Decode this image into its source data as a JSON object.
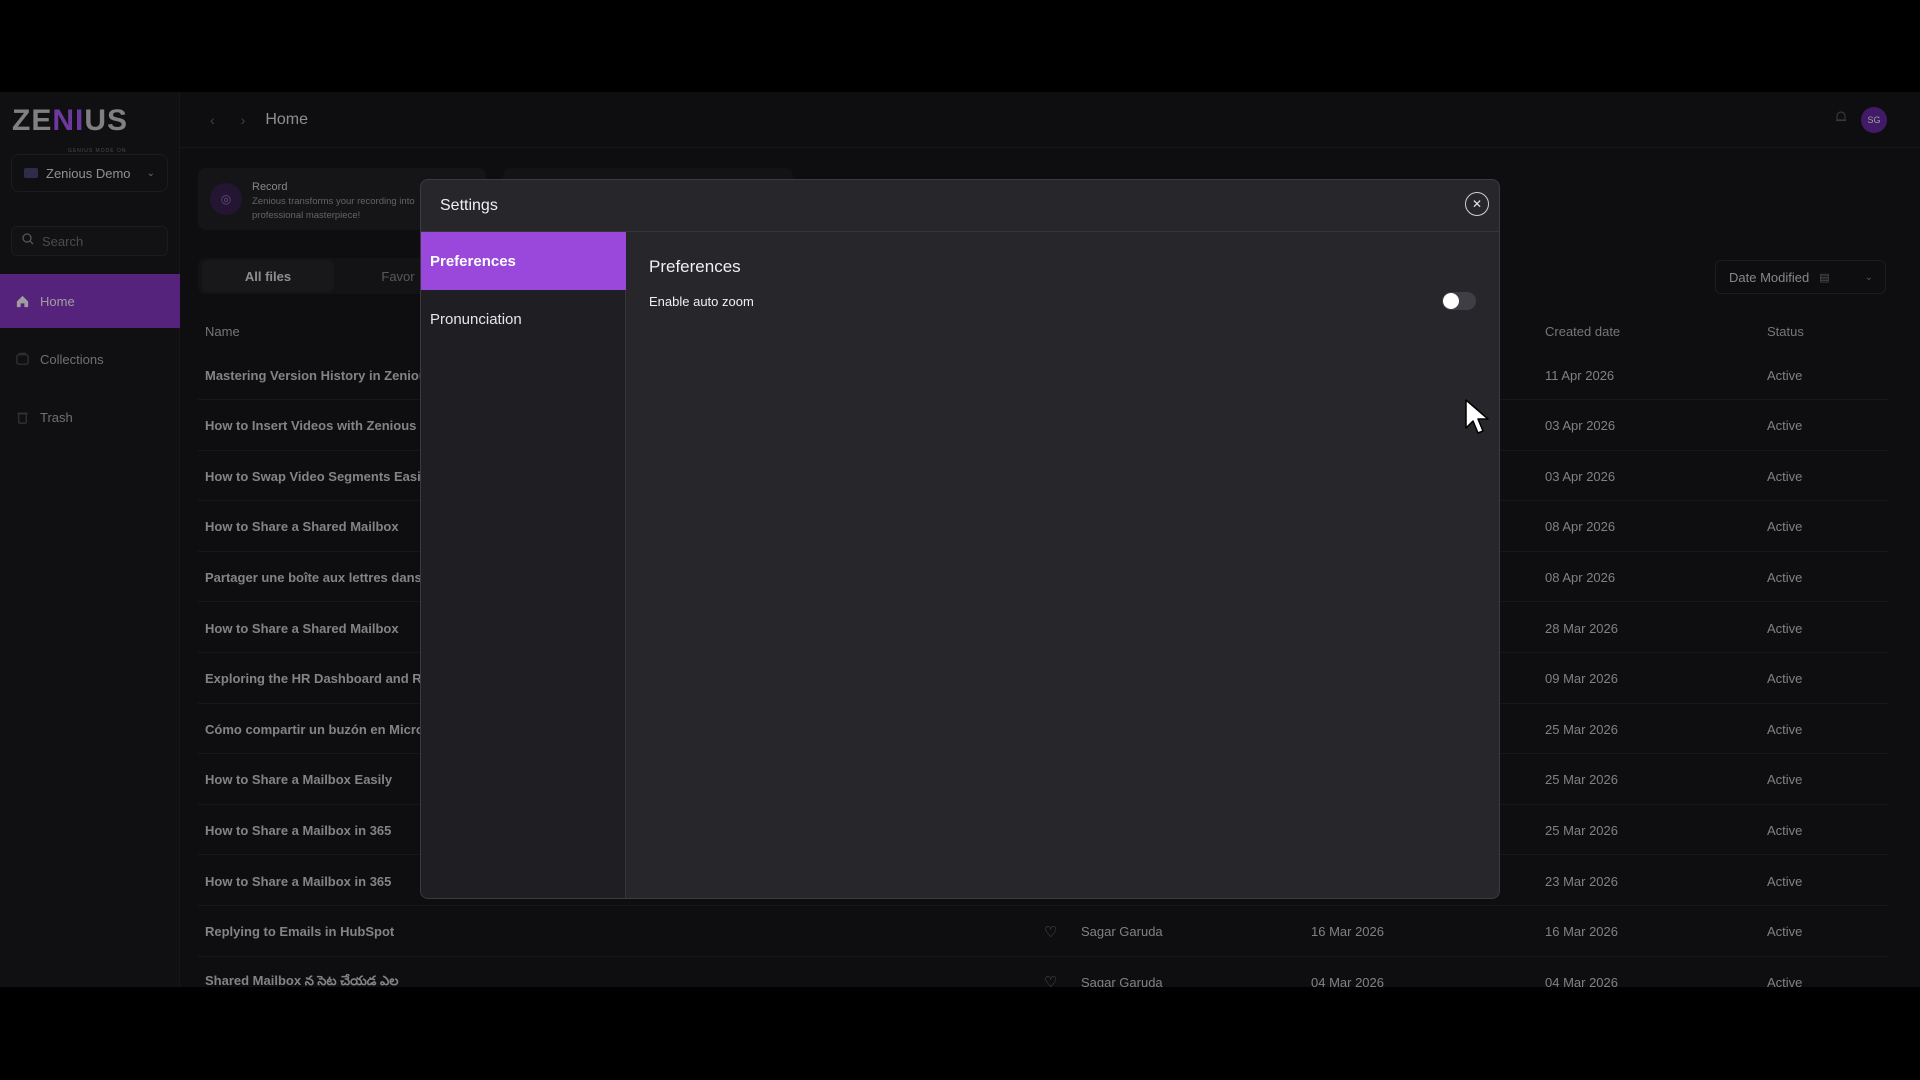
{
  "app": {
    "logo": {
      "left": "ZE",
      "middle": "NI",
      "right": "US",
      "sub": "GENIUS MODE ON"
    },
    "workspace": "Zenious Demo",
    "search_placeholder": "Search",
    "nav": [
      {
        "label": "Home",
        "icon": "home-icon"
      },
      {
        "label": "Collections",
        "icon": "collections-icon"
      },
      {
        "label": "Trash",
        "icon": "trash-icon"
      }
    ]
  },
  "header": {
    "breadcrumb": "Home",
    "avatar_initials": "SG"
  },
  "record_card": {
    "title": "Record",
    "description": "Zenious transforms your recording into professional masterpiece!"
  },
  "tabs": {
    "all_files": "All files",
    "favorites": "Favor"
  },
  "sort": {
    "label": "Date Modified"
  },
  "table": {
    "headers": {
      "name": "Name",
      "created": "Created date",
      "status": "Status"
    },
    "rows": [
      {
        "name": "Mastering Version History in Zenious",
        "owner": "",
        "modified": "",
        "created": "11 Apr 2026",
        "status": "Active"
      },
      {
        "name": "How to Insert Videos with Zenious",
        "owner": "",
        "modified": "",
        "created": "03 Apr 2026",
        "status": "Active"
      },
      {
        "name": "How to Swap Video Segments Easily",
        "owner": "",
        "modified": "",
        "created": "03 Apr 2026",
        "status": "Active"
      },
      {
        "name": "How to Share a Shared Mailbox",
        "owner": "",
        "modified": "",
        "created": "08 Apr 2026",
        "status": "Active"
      },
      {
        "name": "Partager une boîte aux lettres dans",
        "owner": "",
        "modified": "",
        "created": "08 Apr 2026",
        "status": "Active"
      },
      {
        "name": "How to Share a Shared Mailbox",
        "owner": "",
        "modified": "",
        "created": "28 Mar 2026",
        "status": "Active"
      },
      {
        "name": "Exploring the HR Dashboard and Re",
        "owner": "",
        "modified": "",
        "created": "09 Mar 2026",
        "status": "Active"
      },
      {
        "name": "Cómo compartir un buzón en Micros",
        "owner": "",
        "modified": "",
        "created": "25 Mar 2026",
        "status": "Active"
      },
      {
        "name": "How to Share a Mailbox Easily",
        "owner": "",
        "modified": "",
        "created": "25 Mar 2026",
        "status": "Active"
      },
      {
        "name": "How to Share a Mailbox in 365",
        "owner": "",
        "modified": "",
        "created": "25 Mar 2026",
        "status": "Active"
      },
      {
        "name": "How to Share a Mailbox in 365",
        "owner": "",
        "modified": "",
        "created": "23 Mar 2026",
        "status": "Active"
      },
      {
        "name": "Replying to Emails in HubSpot",
        "owner": "Sagar Garuda",
        "modified": "16 Mar 2026",
        "created": "16 Mar 2026",
        "status": "Active"
      },
      {
        "name": "Shared Mailbox న సెట చేయడ ఎల",
        "owner": "Sagar Garuda",
        "modified": "04 Mar 2026",
        "created": "04 Mar 2026",
        "status": "Active"
      }
    ]
  },
  "modal": {
    "title": "Settings",
    "sidebar": [
      "Preferences",
      "Pronunciation"
    ],
    "section_title": "Preferences",
    "option_label": "Enable auto zoom",
    "auto_zoom_enabled": false
  },
  "colors": {
    "accent": "#9a48dc",
    "nav_active": "#8a39c9",
    "background": "#17171a"
  }
}
